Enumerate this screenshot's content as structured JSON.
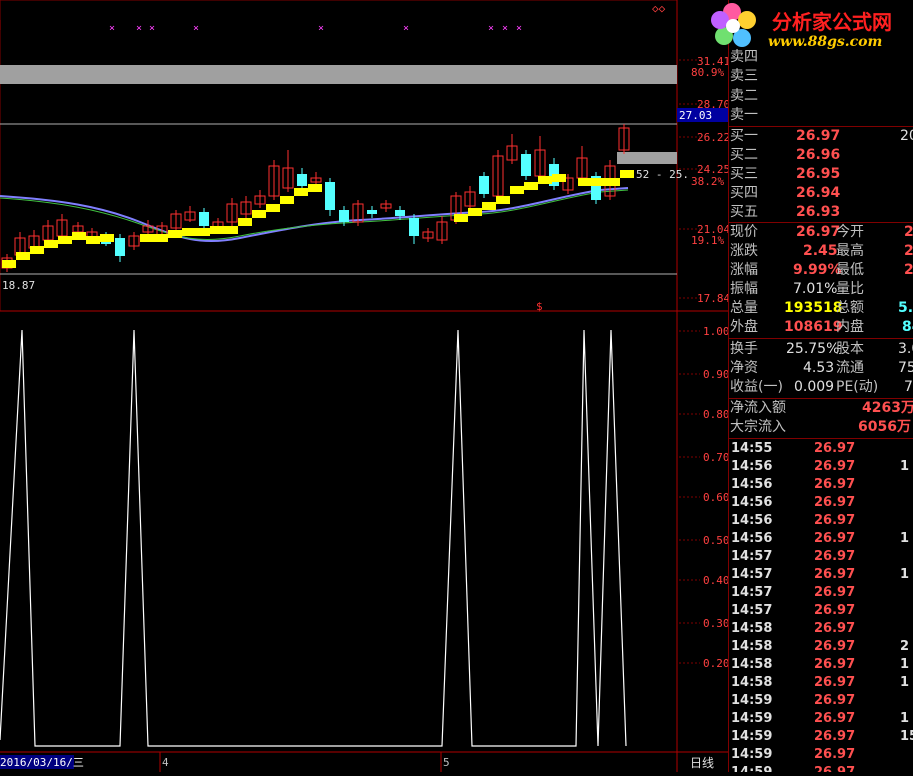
{
  "logo": {
    "title": "分析家公式网",
    "url": "www.88gs.com"
  },
  "price_axis": {
    "labels": [
      "31.41",
      "28.70",
      "26.22",
      "24.25",
      "21.04",
      "17.84"
    ],
    "pct_labels": [
      "80.9%",
      "38.2%",
      "19.1%"
    ],
    "current_price_tag": "27.03",
    "range_label": "52 - 25.",
    "low_label": "18.87",
    "marker": "$"
  },
  "indicator_axis": {
    "labels": [
      "1.00",
      "0.90",
      "0.80",
      "0.70",
      "0.60",
      "0.50",
      "0.40",
      "0.30",
      "0.20"
    ]
  },
  "bottom_bar": {
    "date": "2016/03/16/三",
    "month_markers": [
      "4",
      "5"
    ],
    "period": "日线"
  },
  "order_book": {
    "sell": [
      {
        "label": "卖四"
      },
      {
        "label": "卖三"
      },
      {
        "label": "卖二"
      },
      {
        "label": "卖一"
      }
    ],
    "buy": [
      {
        "label": "买一",
        "price": "26.97",
        "vol": "20"
      },
      {
        "label": "买二",
        "price": "26.96",
        "vol": ""
      },
      {
        "label": "买三",
        "price": "26.95",
        "vol": ""
      },
      {
        "label": "买四",
        "price": "26.94",
        "vol": ""
      },
      {
        "label": "买五",
        "price": "26.93",
        "vol": ""
      }
    ]
  },
  "quote": [
    {
      "l1": "现价",
      "v1": "26.97",
      "l2": "今开",
      "v2": "2"
    },
    {
      "l1": "涨跌",
      "v1": "2.45",
      "l2": "最高",
      "v2": "2"
    },
    {
      "l1": "涨幅",
      "v1": "9.99%",
      "l2": "最低",
      "v2": "2"
    },
    {
      "l1": "振幅",
      "v1": "7.01%",
      "l2": "量比",
      "v2": ""
    },
    {
      "l1": "总量",
      "v1": "193518",
      "l2": "总额",
      "v2": "5.0"
    },
    {
      "l1": "外盘",
      "v1": "108619",
      "l2": "内盘",
      "v2": "84"
    }
  ],
  "fundamentals": [
    {
      "l1": "换手",
      "v1": "25.75%",
      "l2": "股本",
      "v2": "3.0"
    },
    {
      "l1": "净资",
      "v1": "4.53",
      "l2": "流通",
      "v2": "75"
    },
    {
      "l1": "收益(一)",
      "v1": "0.009",
      "l2": "PE(动)",
      "v2": "7"
    }
  ],
  "flows": [
    {
      "label": "净流入额",
      "value": "4263万"
    },
    {
      "label": "大宗流入",
      "value": "6056万"
    }
  ],
  "ticks": [
    {
      "time": "14:55",
      "price": "26.97",
      "vol": ""
    },
    {
      "time": "14:56",
      "price": "26.97",
      "vol": "1"
    },
    {
      "time": "14:56",
      "price": "26.97",
      "vol": ""
    },
    {
      "time": "14:56",
      "price": "26.97",
      "vol": ""
    },
    {
      "time": "14:56",
      "price": "26.97",
      "vol": ""
    },
    {
      "time": "14:56",
      "price": "26.97",
      "vol": "1"
    },
    {
      "time": "14:57",
      "price": "26.97",
      "vol": ""
    },
    {
      "time": "14:57",
      "price": "26.97",
      "vol": "1"
    },
    {
      "time": "14:57",
      "price": "26.97",
      "vol": ""
    },
    {
      "time": "14:57",
      "price": "26.97",
      "vol": ""
    },
    {
      "time": "14:58",
      "price": "26.97",
      "vol": ""
    },
    {
      "time": "14:58",
      "price": "26.97",
      "vol": "2"
    },
    {
      "time": "14:58",
      "price": "26.97",
      "vol": "1"
    },
    {
      "time": "14:58",
      "price": "26.97",
      "vol": "1"
    },
    {
      "time": "14:59",
      "price": "26.97",
      "vol": ""
    },
    {
      "time": "14:59",
      "price": "26.97",
      "vol": "1"
    },
    {
      "time": "14:59",
      "price": "26.97",
      "vol": "15"
    },
    {
      "time": "14:59",
      "price": "26.97",
      "vol": ""
    },
    {
      "time": "14:59",
      "price": "26.97",
      "vol": ""
    }
  ],
  "colors": {
    "up": "#ff3030",
    "down": "#54ffff",
    "signal": "#ffff00",
    "border": "#800000"
  }
}
